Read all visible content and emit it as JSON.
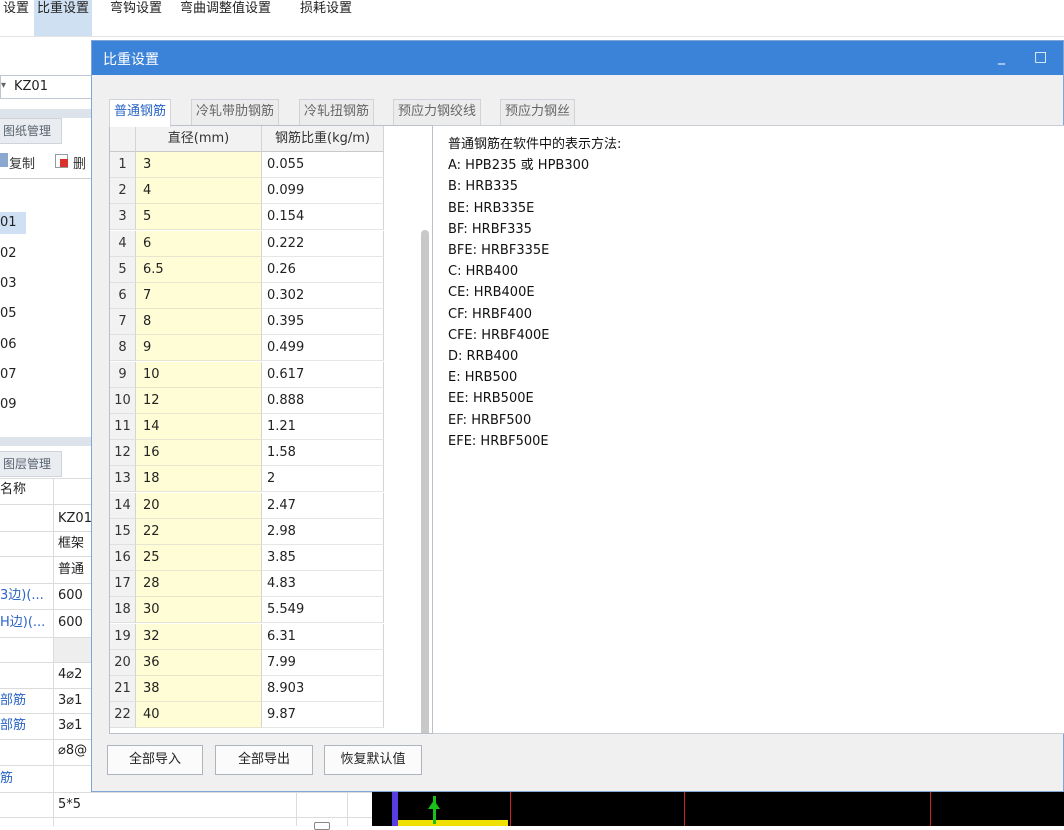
{
  "top_menu": [
    {
      "label": "设置",
      "active": false
    },
    {
      "label": "比重设置",
      "active": true
    },
    {
      "label": "弯钩设置",
      "active": false
    },
    {
      "label": "弯曲调整值设置",
      "active": false
    },
    {
      "label": "损耗设置",
      "active": false
    }
  ],
  "left": {
    "component_value": "KZ01",
    "drawing_tab": "图纸管理",
    "toolbar": {
      "copy": "复制",
      "delete": "删"
    },
    "tree_items": [
      "01",
      "02",
      "03",
      "05",
      "06",
      "07",
      "09"
    ],
    "floor_tab": "图层管理",
    "prop_header": "名称",
    "prop_rows": [
      {
        "name": "",
        "value": "KZ01",
        "blue": false
      },
      {
        "name": "",
        "value": "框架",
        "blue": false
      },
      {
        "name": "",
        "value": "普通",
        "blue": false
      },
      {
        "name": "3边)(...",
        "value": "600",
        "blue": true
      },
      {
        "name": "H边)(...",
        "value": "600",
        "blue": true
      },
      {
        "name": "",
        "value": "",
        "blue": false
      },
      {
        "name": "",
        "value": "4⌀2",
        "blue": false
      },
      {
        "name": "部筋",
        "value": "3⌀1",
        "blue": true
      },
      {
        "name": "部筋",
        "value": "3⌀1",
        "blue": true
      },
      {
        "name": "",
        "value": "⌀8@",
        "blue": false
      },
      {
        "name": "筋",
        "value": "",
        "blue": true
      },
      {
        "name": "",
        "value": "5*5",
        "blue": false
      }
    ]
  },
  "dialog": {
    "title": "比重设置",
    "controls": {
      "minimize": "_",
      "maximize": "□"
    },
    "tabs": [
      {
        "label": "普通钢筋",
        "active": true
      },
      {
        "label": "冷轧带肋钢筋",
        "active": false
      },
      {
        "label": "冷轧扭钢筋",
        "active": false
      },
      {
        "label": "预应力钢绞线",
        "active": false
      },
      {
        "label": "预应力钢丝",
        "active": false
      }
    ],
    "table": {
      "headers": [
        "直径(mm)",
        "钢筋比重(kg/m)"
      ],
      "rows": [
        {
          "n": "1",
          "d": "3",
          "w": "0.055"
        },
        {
          "n": "2",
          "d": "4",
          "w": "0.099"
        },
        {
          "n": "3",
          "d": "5",
          "w": "0.154"
        },
        {
          "n": "4",
          "d": "6",
          "w": "0.222"
        },
        {
          "n": "5",
          "d": "6.5",
          "w": "0.26"
        },
        {
          "n": "6",
          "d": "7",
          "w": "0.302"
        },
        {
          "n": "7",
          "d": "8",
          "w": "0.395"
        },
        {
          "n": "8",
          "d": "9",
          "w": "0.499"
        },
        {
          "n": "9",
          "d": "10",
          "w": "0.617"
        },
        {
          "n": "10",
          "d": "12",
          "w": "0.888"
        },
        {
          "n": "11",
          "d": "14",
          "w": "1.21"
        },
        {
          "n": "12",
          "d": "16",
          "w": "1.58"
        },
        {
          "n": "13",
          "d": "18",
          "w": "2"
        },
        {
          "n": "14",
          "d": "20",
          "w": "2.47"
        },
        {
          "n": "15",
          "d": "22",
          "w": "2.98"
        },
        {
          "n": "16",
          "d": "25",
          "w": "3.85"
        },
        {
          "n": "17",
          "d": "28",
          "w": "4.83"
        },
        {
          "n": "18",
          "d": "30",
          "w": "5.549"
        },
        {
          "n": "19",
          "d": "32",
          "w": "6.31"
        },
        {
          "n": "20",
          "d": "36",
          "w": "7.99"
        },
        {
          "n": "21",
          "d": "38",
          "w": "8.903"
        },
        {
          "n": "22",
          "d": "40",
          "w": "9.87"
        }
      ]
    },
    "description": [
      "普通钢筋在软件中的表示方法:",
      "A:  HPB235 或 HPB300",
      "B:  HRB335",
      "BE:  HRB335E",
      "BF:  HRBF335",
      "BFE: HRBF335E",
      "C:  HRB400",
      "CE:  HRB400E",
      "CF:  HRBF400",
      "CFE: HRBF400E",
      "D:  RRB400",
      "E:  HRB500",
      "EE:  HRB500E",
      "EF:  HRBF500",
      "EFE: HRBF500E"
    ],
    "buttons": {
      "import_all": "全部导入",
      "export_all": "全部导出",
      "restore_default": "恢复默认值"
    }
  },
  "colors": {
    "title_bar": "#3b83d8",
    "accent_blue": "#2a64c6",
    "diameter_cell": "#fffdd5",
    "active_menu": "#cfe0f2"
  }
}
